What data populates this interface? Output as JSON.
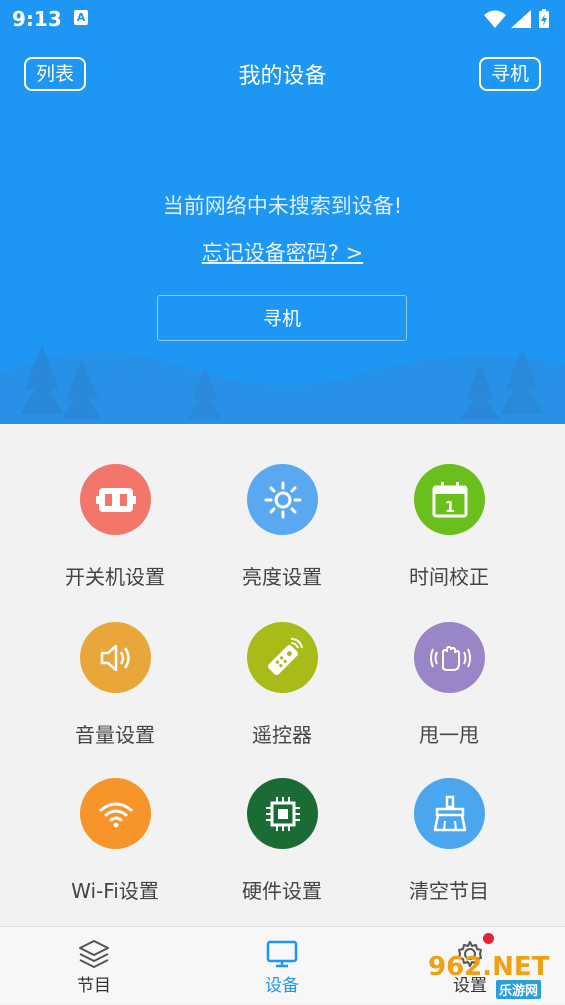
{
  "statusbar": {
    "time": "9:13",
    "badge": "A"
  },
  "header": {
    "title": "我的设备",
    "left_button": "列表",
    "right_button": "寻机"
  },
  "main": {
    "message": "当前网络中未搜索到设备!",
    "forgot_link": "忘记设备密码? >",
    "search_button": "寻机"
  },
  "features": [
    {
      "label": "开关机设置",
      "icon": "power-plug-icon",
      "color": "#f2766a"
    },
    {
      "label": "亮度设置",
      "icon": "brightness-icon",
      "color": "#5aa9f0"
    },
    {
      "label": "时间校正",
      "icon": "calendar-icon",
      "color": "#6bbf1c"
    },
    {
      "label": "音量设置",
      "icon": "volume-icon",
      "color": "#e9a63a"
    },
    {
      "label": "遥控器",
      "icon": "remote-control-icon",
      "color": "#a8bb18"
    },
    {
      "label": "甩一甩",
      "icon": "shake-hand-icon",
      "color": "#9a86c6"
    },
    {
      "label": "Wi-Fi设置",
      "icon": "wifi-icon",
      "color": "#f7952a"
    },
    {
      "label": "硬件设置",
      "icon": "chip-icon",
      "color": "#1a6b34"
    },
    {
      "label": "清空节目",
      "icon": "broom-icon",
      "color": "#4aa6ee"
    }
  ],
  "tabbar": {
    "tabs": [
      {
        "label": "节目",
        "icon": "layers-icon"
      },
      {
        "label": "设备",
        "icon": "monitor-icon"
      },
      {
        "label": "设置",
        "icon": "gear-icon"
      }
    ]
  },
  "watermark": {
    "text": "962.NET",
    "sub": "乐游网"
  },
  "colors": {
    "primary": "#1e96f3",
    "notification": "#e8202f"
  }
}
